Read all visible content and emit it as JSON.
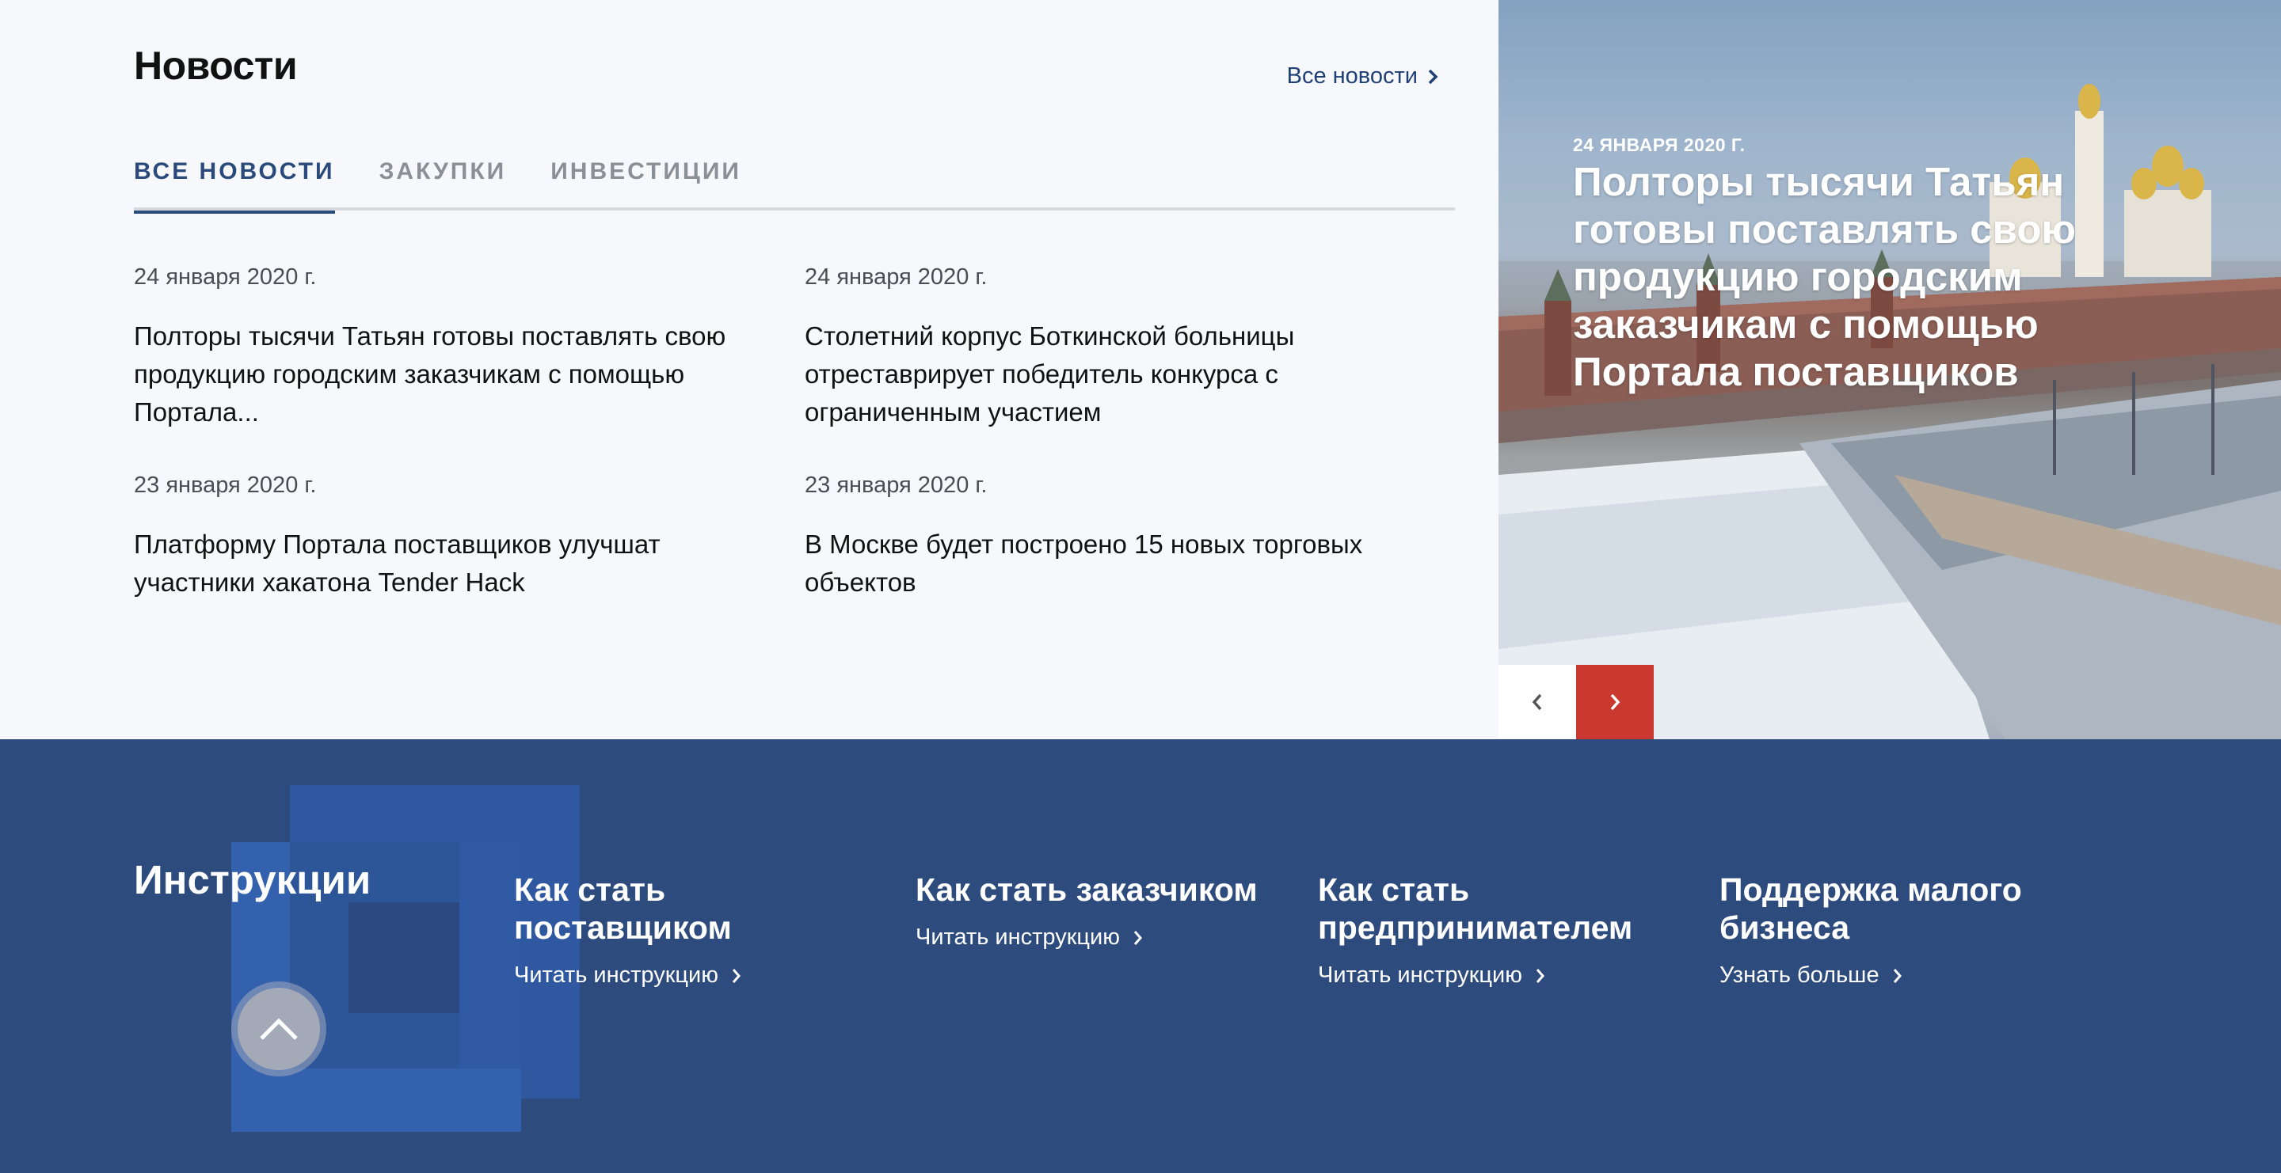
{
  "news": {
    "title": "Новости",
    "all_link": "Все новости",
    "tabs": [
      {
        "label": "ВСЕ НОВОСТИ",
        "active": true
      },
      {
        "label": "ЗАКУПКИ",
        "active": false
      },
      {
        "label": "ИНВЕСТИЦИИ",
        "active": false
      }
    ],
    "items": [
      {
        "date": "24 января 2020 г.",
        "headline": "Полторы тысячи Татьян готовы поставлять свою продукцию городским заказчикам с помощью Портала..."
      },
      {
        "date": "24 января 2020 г.",
        "headline": "Столетний корпус Боткинской больницы отреставрирует победитель конкурса с ограниченным участием"
      },
      {
        "date": "23 января 2020 г.",
        "headline": "Платформу Портала поставщиков улучшат участники хакатона Tender Hack"
      },
      {
        "date": "23 января 2020 г.",
        "headline": "В Москве будет построено 15 новых торговых объектов"
      }
    ]
  },
  "hero": {
    "date": "24 ЯНВАРЯ 2020 Г.",
    "title": "Полторы тысячи Татьян готовы поставлять свою продукцию городским заказчикам с помощью Портала поставщиков",
    "prev_icon": "chevron-left-icon",
    "next_icon": "chevron-right-icon",
    "next_color": "#c9392f"
  },
  "instructions": {
    "title": "Инструкции",
    "columns": [
      {
        "title": "Как стать поставщиком",
        "link": "Читать инструкцию"
      },
      {
        "title": "Как стать заказчиком",
        "link": "Читать инструкцию"
      },
      {
        "title": "Как стать предпринимателем",
        "link": "Читать инструкцию"
      },
      {
        "title": "Поддержка малого бизнеса",
        "link": "Узнать больше"
      }
    ],
    "background_color": "#2e4b7e",
    "scroll_top_icon": "chevron-up-icon"
  },
  "colors": {
    "accent": "#2b4a7c",
    "link": "#1f3f75",
    "brand_red": "#c9392f"
  }
}
